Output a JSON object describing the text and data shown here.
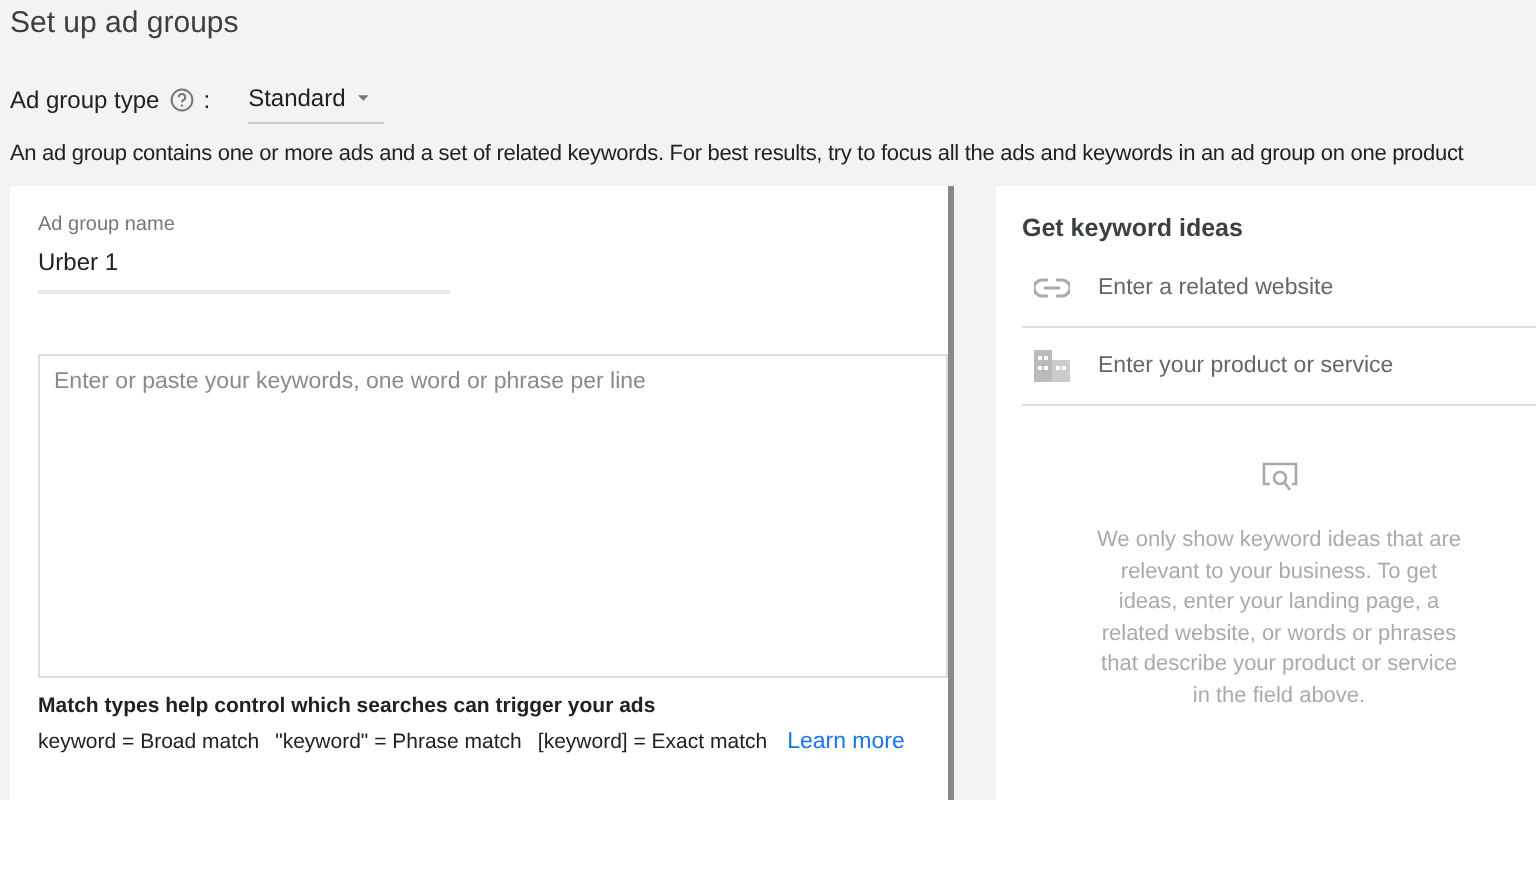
{
  "page_title": "Set up ad groups",
  "ad_group_type": {
    "label": "Ad group type",
    "separator": ":",
    "value": "Standard"
  },
  "description": "An ad group contains one or more ads and a set of related keywords. For best results, try to focus all the ads and keywords in an ad group on one product",
  "ad_group_name": {
    "label": "Ad group name",
    "value": "Urber 1"
  },
  "keywords": {
    "placeholder": "Enter or paste your keywords, one word or phrase per line"
  },
  "match_types": {
    "heading": "Match types help control which searches can trigger your ads",
    "items": [
      "keyword = Broad match",
      "\"keyword\" = Phrase match",
      "[keyword] = Exact match"
    ],
    "link": "Learn more"
  },
  "keyword_ideas": {
    "title": "Get keyword ideas",
    "fields": [
      {
        "kind": "link",
        "placeholder": "Enter a related website"
      },
      {
        "kind": "building",
        "placeholder": "Enter your product or service"
      }
    ],
    "empty_message": "We only show keyword ideas that are relevant to your business. To get ideas, enter your landing page, a related website, or words or phrases that describe your product or service in the field above."
  }
}
